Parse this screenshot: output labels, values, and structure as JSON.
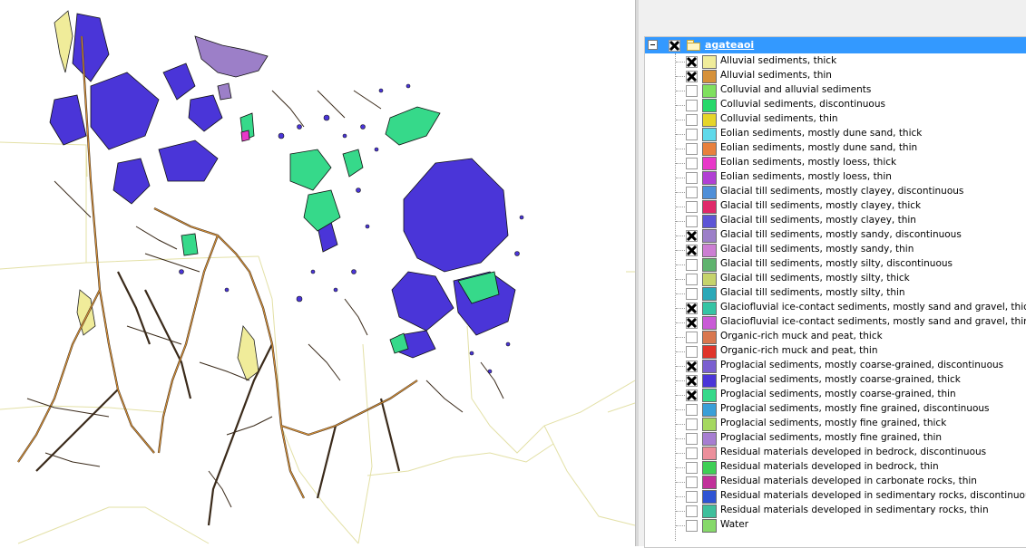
{
  "layers_panel": {
    "group": {
      "name": "agateaoi",
      "checked": true
    },
    "items": [
      {
        "label": "Alluvial sediments, thick",
        "color": "#f0ec9a",
        "checked": true
      },
      {
        "label": "Alluvial sediments, thin",
        "color": "#d6913a",
        "checked": true
      },
      {
        "label": "Colluvial and alluvial sediments",
        "color": "#7fe05f",
        "checked": false
      },
      {
        "label": "Colluvial sediments, discontinuous",
        "color": "#27d86a",
        "checked": false
      },
      {
        "label": "Colluvial sediments, thin",
        "color": "#e6d52a",
        "checked": false
      },
      {
        "label": "Eolian sediments, mostly dune sand, thick",
        "color": "#5fd9ea",
        "checked": false
      },
      {
        "label": "Eolian sediments, mostly dune sand, thin",
        "color": "#e8803d",
        "checked": false
      },
      {
        "label": "Eolian sediments, mostly loess, thick",
        "color": "#e838c9",
        "checked": false
      },
      {
        "label": "Eolian sediments, mostly loess, thin",
        "color": "#b13fd4",
        "checked": false
      },
      {
        "label": "Glacial till sediments, mostly clayey, discontinuous",
        "color": "#4f8fd8",
        "checked": false
      },
      {
        "label": "Glacial till sediments, mostly clayey, thick",
        "color": "#e0296a",
        "checked": false
      },
      {
        "label": "Glacial till sediments, mostly clayey, thin",
        "color": "#5c55d6",
        "checked": false
      },
      {
        "label": "Glacial till sediments, mostly sandy, discontinuous",
        "color": "#9c7fc8",
        "checked": true
      },
      {
        "label": "Glacial till sediments, mostly sandy, thin",
        "color": "#cc7ed3",
        "checked": true
      },
      {
        "label": "Glacial till sediments, mostly silty, discontinuous",
        "color": "#5fb36e",
        "checked": false
      },
      {
        "label": "Glacial till sediments, mostly silty, thick",
        "color": "#c6d36b",
        "checked": false
      },
      {
        "label": "Glacial till sediments, mostly silty, thin",
        "color": "#2aa8b8",
        "checked": false
      },
      {
        "label": "Glaciofluvial ice-contact sediments, mostly sand and gravel, thick",
        "color": "#35c4a4",
        "checked": true
      },
      {
        "label": "Glaciofluvial ice-contact sediments, mostly sand and gravel, thin",
        "color": "#c95ad6",
        "checked": true
      },
      {
        "label": "Organic-rich muck and peat, thick",
        "color": "#d9774f",
        "checked": false
      },
      {
        "label": "Organic-rich muck and peat, thin",
        "color": "#e0342a",
        "checked": false
      },
      {
        "label": "Proglacial sediments, mostly coarse-grained, discontinuous",
        "color": "#7a5fd0",
        "checked": true
      },
      {
        "label": "Proglacial sediments, mostly coarse-grained, thick",
        "color": "#4a35d8",
        "checked": true
      },
      {
        "label": "Proglacial sediments, mostly coarse-grained, thin",
        "color": "#36d98a",
        "checked": true
      },
      {
        "label": "Proglacial sediments, mostly fine grained, discontinuous",
        "color": "#3a9fd8",
        "checked": false
      },
      {
        "label": "Proglacial sediments, mostly fine grained, thick",
        "color": "#a5d860",
        "checked": false
      },
      {
        "label": "Proglacial sediments, mostly fine grained, thin",
        "color": "#a77ed2",
        "checked": false
      },
      {
        "label": "Residual materials developed in bedrock, discontinuous",
        "color": "#ec8f9b",
        "checked": false
      },
      {
        "label": "Residual materials developed in bedrock, thin",
        "color": "#3ecf55",
        "checked": false
      },
      {
        "label": "Residual materials developed in carbonate rocks, thin",
        "color": "#c1309a",
        "checked": false
      },
      {
        "label": "Residual materials developed in sedimentary rocks, discontinuous",
        "color": "#2f54d4",
        "checked": false
      },
      {
        "label": "Residual materials developed in sedimentary rocks, thin",
        "color": "#3fbf9c",
        "checked": false
      },
      {
        "label": "Water",
        "color": "#86d96a",
        "checked": false
      }
    ]
  }
}
